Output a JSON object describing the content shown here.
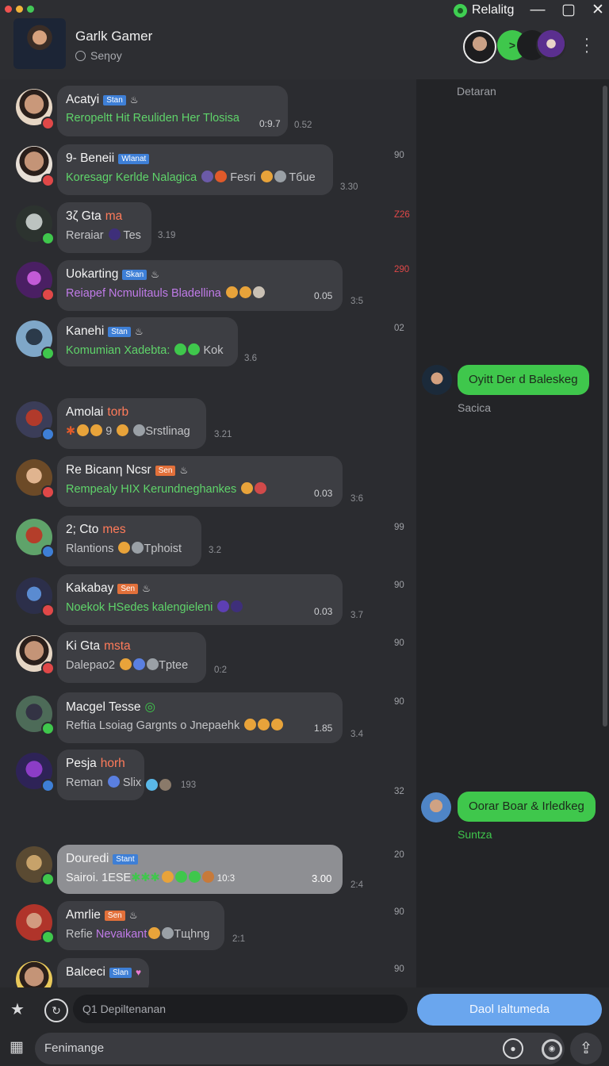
{
  "colors": {
    "accent": "#6aa6ee",
    "green": "#3fc74c",
    "purple": "#c07be8",
    "red": "#e04848",
    "tag_blue": "#3e7fd6",
    "tag_orange": "#e2703a"
  },
  "header": {
    "title": "Garlk Gamer",
    "subtitle": "Seηoy",
    "brand": "Relalitg",
    "minimize": "—",
    "restore": "▢",
    "close": "✕",
    "play": ">"
  },
  "side": {
    "heading": "Detaran",
    "messages": [
      {
        "text": "Oyitt Der d Baleskeg",
        "name": "Sacica"
      },
      {
        "text": "Oorar Boar & Irledkeg",
        "name": "Suntza"
      }
    ]
  },
  "chats": [
    {
      "name": "Acatyi",
      "name_suffix": "",
      "tag": "Stan",
      "tag_color": "blue",
      "extra": "♨",
      "msg": "Reropeltt Hit Reuliden Her Tlosisa",
      "msg_color": "green",
      "time": "0:9.7",
      "outside_time": "0.52",
      "count": "",
      "count_red": false
    },
    {
      "name": "9- Beneii",
      "name_suffix": "",
      "tag": "Wlanat",
      "tag_color": "blue",
      "extra": "",
      "msg": "Koresagr Kerlde Nalagica",
      "msg_color": "green",
      "emoji_text": "Fesri",
      "emoji_text2": "Tбue",
      "time": "",
      "outside_time": "3.30",
      "count": "90",
      "count_red": false
    },
    {
      "name": "3ζ Gta",
      "name_suffix": "ma",
      "tag": "",
      "tag_color": "",
      "extra": "",
      "msg": "Reraiar",
      "msg_color": "gray",
      "emoji_text": "Tes",
      "time": "3.19",
      "outside_time": "",
      "count": "Z26",
      "count_red": true
    },
    {
      "name": "Uokarting",
      "name_suffix": "",
      "tag": "Skan",
      "tag_color": "blue",
      "extra": "♨",
      "msg": "Reiapef Ncmulitauls Bladellina",
      "msg_color": "purple",
      "time": "0.05",
      "outside_time": "3:5",
      "count": "290",
      "count_red": true
    },
    {
      "name": "Kanehi",
      "name_suffix": "",
      "tag": "Stan",
      "tag_color": "blue",
      "extra": "♨",
      "msg": "Komumian Xadebta:",
      "msg_color": "green",
      "emoji_text": "Kok",
      "time": "",
      "outside_time": "3.6",
      "count": "02",
      "count_red": false
    },
    {
      "name": "Amolai",
      "name_suffix": "torb",
      "tag": "",
      "tag_color": "",
      "extra": "",
      "msg": "9",
      "msg_color": "gray",
      "emoji_text": "Srstlinag",
      "time": "",
      "outside_time": "3.21",
      "count": "",
      "count_red": false
    },
    {
      "name": "Re Bicanη Ncsr",
      "name_suffix": "",
      "tag": "Sen",
      "tag_color": "orange",
      "extra": "♨",
      "msg": "Rempealy HIX Kerundneghankes",
      "msg_color": "green",
      "time": "0.03",
      "outside_time": "3:6",
      "count": "",
      "count_red": false
    },
    {
      "name": "2; Cto",
      "name_suffix": "mes",
      "tag": "",
      "tag_color": "",
      "extra": "",
      "msg": "Rlantions",
      "msg_color": "gray",
      "emoji_text": "Tphoist",
      "time": "",
      "outside_time": "3.2",
      "count": "99",
      "count_red": false
    },
    {
      "name": "Kakabay",
      "name_suffix": "",
      "tag": "Sen",
      "tag_color": "orange",
      "extra": "♨",
      "msg": "Noekok HSedes kalengieleni",
      "msg_color": "green",
      "time": "0.03",
      "outside_time": "3.7",
      "count": "90",
      "count_red": false
    },
    {
      "name": "Ki Gta",
      "name_suffix": "msta",
      "tag": "",
      "tag_color": "",
      "extra": "",
      "msg": "Dalepao2",
      "msg_color": "gray",
      "emoji_text": "Tptee",
      "time": "",
      "outside_time": "0:2",
      "count": "90",
      "count_red": false
    },
    {
      "name": "Macgel Tesse",
      "name_suffix": "",
      "tag": "",
      "tag_color": "",
      "extra": "◎",
      "msg": "Reftia Lsoiag Gargnts o Jnepaehk",
      "msg_color": "gray",
      "time": "1.85",
      "outside_time": "3.4",
      "count": "90",
      "count_red": false
    },
    {
      "name": "Pesja",
      "name_suffix": "horh",
      "tag": "",
      "tag_color": "",
      "extra": "",
      "msg": "Reman",
      "msg_color": "gray",
      "emoji_text": "Slix",
      "time": "",
      "outside_time": "193",
      "count": "32",
      "count_red": false
    },
    {
      "name": "Douredi",
      "name_suffix": "",
      "tag": "Stant",
      "tag_color": "blue",
      "extra": "",
      "msg": "Sairoi. 1ESE",
      "msg_color": "gray",
      "emoji_text": "10:3",
      "time": "3.00",
      "outside_time": "2:4",
      "count": "20",
      "count_red": false
    },
    {
      "name": "Amrlie",
      "name_suffix": "",
      "tag": "Sen",
      "tag_color": "orange",
      "extra": "♨",
      "msg": "Refie",
      "msg_color": "gray",
      "msg_purple_part": "Nevaikant",
      "emoji_text": "Tщhng",
      "time": "",
      "outside_time": "2:1",
      "count": "90",
      "count_red": false
    },
    {
      "name": "Balceci",
      "name_suffix": "",
      "tag": "Slan",
      "tag_color": "blue",
      "extra": "♥",
      "msg": "",
      "msg_color": "gray",
      "time": "",
      "outside_time": "",
      "count": "90",
      "count_red": false
    }
  ],
  "bottom": {
    "search_placeholder": "Q1  Depiltenanan",
    "primary_button": "Daol Ialtumeda",
    "compose_placeholder": "Fenimange"
  }
}
